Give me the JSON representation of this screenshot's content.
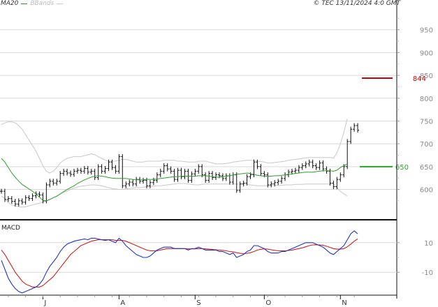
{
  "header": {
    "ma_label": "MA20",
    "bbands_label": "BBands",
    "copyright": "© TEC 13/11/2024 4:0 GMT"
  },
  "macd_panel": {
    "title": "MACD"
  },
  "colors": {
    "price_bar": "#111111",
    "ma20": "#2ca02c",
    "bbands": "#c8c8c8",
    "resistance": "#cc0000",
    "support": "#2ca02c",
    "macd": "#2233cc",
    "signal": "#cc2222",
    "grid": "#d9d9d9"
  },
  "chart_data": {
    "type": "ohlc",
    "title": "",
    "price_axis": {
      "ticks": [
        {
          "value": 950,
          "label": "950"
        },
        {
          "value": 900,
          "label": "900"
        },
        {
          "value": 850,
          "label": "850"
        },
        {
          "value": 800,
          "label": "800"
        },
        {
          "value": 750,
          "label": "750"
        },
        {
          "value": 700,
          "label": "700"
        },
        {
          "value": 650,
          "label": "650"
        },
        {
          "value": 600,
          "label": "600"
        }
      ],
      "ylim": [
        535,
        1000
      ]
    },
    "x_axis": {
      "ticks": [
        {
          "index": 12,
          "label": "J"
        },
        {
          "index": 34,
          "label": "A"
        },
        {
          "index": 56,
          "label": "S"
        },
        {
          "index": 76,
          "label": "O"
        },
        {
          "index": 98,
          "label": "N"
        }
      ],
      "count": 104
    },
    "levels": [
      {
        "name": "resistance",
        "value": 844,
        "label": "844"
      },
      {
        "name": "support",
        "value": 650,
        "label": "650"
      }
    ],
    "price_close": [
      596,
      578,
      580,
      574,
      568,
      575,
      572,
      582,
      580,
      586,
      590,
      588,
      575,
      610,
      618,
      614,
      618,
      635,
      640,
      636,
      633,
      640,
      642,
      640,
      646,
      638,
      640,
      626,
      650,
      640,
      646,
      660,
      648,
      640,
      672,
      608,
      612,
      616,
      612,
      622,
      618,
      620,
      608,
      615,
      620,
      632,
      640,
      652,
      645,
      640,
      622,
      642,
      628,
      640,
      620,
      634,
      640,
      650,
      632,
      620,
      635,
      626,
      632,
      630,
      624,
      630,
      616,
      632,
      598,
      612,
      614,
      628,
      632,
      660,
      650,
      635,
      632,
      610,
      612,
      615,
      618,
      624,
      632,
      638,
      640,
      642,
      648,
      652,
      656,
      660,
      652,
      648,
      658,
      645,
      640,
      614,
      606,
      622,
      632,
      650,
      705,
      732,
      740,
      730
    ],
    "bar_range": 12,
    "ma20": [
      668,
      660,
      648,
      636,
      627,
      618,
      611,
      606,
      601,
      596,
      590,
      583,
      576,
      575,
      578,
      582,
      585,
      590,
      595,
      600,
      604,
      608,
      613,
      617,
      621,
      624,
      627,
      629,
      630,
      629,
      628,
      626,
      625,
      624,
      624,
      624,
      624,
      623,
      622,
      621,
      621,
      621,
      622,
      622,
      622,
      623,
      624,
      625,
      626,
      627,
      628,
      628,
      629,
      629,
      629,
      629,
      629,
      630,
      630,
      630,
      629,
      628,
      627,
      627,
      628,
      629,
      630,
      632,
      633,
      634,
      635,
      636,
      635,
      633,
      631,
      630,
      629,
      629,
      629,
      630,
      630,
      631,
      632,
      633,
      634,
      635,
      636,
      637,
      638,
      638,
      638,
      639,
      640,
      641,
      641,
      641,
      640,
      642,
      648,
      652,
      656
    ],
    "bb_upper": [
      742,
      746,
      748,
      748,
      746,
      740,
      732,
      720,
      708,
      696,
      684,
      668,
      652,
      640,
      636,
      640,
      648,
      658,
      664,
      668,
      670,
      672,
      672,
      672,
      674,
      676,
      678,
      676,
      672,
      668,
      664,
      662,
      662,
      662,
      664,
      666,
      666,
      664,
      662,
      660,
      660,
      660,
      662,
      662,
      662,
      662,
      662,
      664,
      664,
      664,
      664,
      662,
      662,
      661,
      660,
      660,
      660,
      662,
      662,
      662,
      660,
      658,
      656,
      656,
      656,
      657,
      658,
      660,
      661,
      662,
      663,
      664,
      664,
      663,
      662,
      661,
      660,
      658,
      658,
      659,
      660,
      661,
      662,
      664,
      665,
      666,
      667,
      668,
      669,
      670,
      670,
      670,
      670,
      670,
      670,
      670,
      669,
      680,
      700,
      725,
      755
    ],
    "bb_lower": [
      586,
      580,
      571,
      566,
      564,
      562,
      561,
      562,
      564,
      566,
      568,
      570,
      572,
      574,
      578,
      582,
      586,
      590,
      594,
      597,
      600,
      603,
      605,
      607,
      608,
      609,
      610,
      610,
      609,
      608,
      606,
      604,
      602,
      601,
      600,
      600,
      601,
      602,
      603,
      604,
      604,
      605,
      606,
      607,
      607,
      608,
      608,
      609,
      610,
      611,
      612,
      613,
      613,
      613,
      612,
      611,
      610,
      610,
      611,
      612,
      612,
      612,
      612,
      612,
      612,
      612,
      612,
      612,
      612,
      612,
      612,
      611,
      610,
      609,
      608,
      608,
      608,
      608,
      608,
      609,
      609,
      609,
      610,
      610,
      610,
      611,
      611,
      611,
      612,
      612,
      612,
      612,
      612,
      612,
      612,
      612,
      612,
      604,
      596,
      590,
      586
    ],
    "macd_axis": {
      "ticks": [
        {
          "value": 10,
          "label": "10"
        },
        {
          "value": -10,
          "label": "-10"
        }
      ],
      "ylim": [
        -25,
        25
      ]
    },
    "macd": [
      -2,
      -8,
      -14,
      -18,
      -21,
      -23,
      -24,
      -23,
      -22,
      -21,
      -20,
      -18,
      -15,
      -10,
      -6,
      -3,
      0,
      4,
      7,
      9,
      10,
      11,
      11.5,
      12,
      12.5,
      12,
      13,
      13,
      12.5,
      12,
      11.5,
      12,
      11,
      10,
      13,
      11,
      8,
      6,
      4,
      2,
      1,
      0,
      0,
      1,
      3,
      5,
      6,
      7,
      7,
      7,
      6,
      6,
      6,
      6,
      5,
      6,
      6,
      7,
      6,
      5,
      5,
      5,
      5,
      4,
      4,
      3,
      2,
      3,
      0,
      1,
      2,
      4,
      5,
      8,
      8,
      7,
      6,
      4,
      3,
      3,
      3,
      4,
      4,
      5,
      6,
      7,
      8,
      9,
      10,
      10,
      10,
      9,
      8,
      7,
      5,
      3,
      2,
      4,
      6,
      8,
      12,
      16,
      18,
      16
    ],
    "signal": [
      5,
      2,
      -2,
      -6,
      -10,
      -13,
      -16,
      -18,
      -19,
      -20,
      -20,
      -20,
      -19,
      -17,
      -15,
      -13,
      -10,
      -7,
      -4,
      -1,
      2,
      4,
      6,
      8,
      9,
      10,
      11,
      11.5,
      12,
      12,
      12,
      12,
      12,
      11.5,
      11.5,
      11.5,
      11,
      10,
      9,
      8,
      7,
      6,
      5,
      4.5,
      4.5,
      4.5,
      5,
      5.5,
      6,
      6,
      6,
      6,
      6,
      6,
      5.8,
      5.8,
      5.8,
      6,
      6,
      5.8,
      5.6,
      5.4,
      5.2,
      5,
      4.8,
      4.5,
      4,
      3.8,
      3.2,
      2.8,
      2.6,
      2.8,
      3.2,
      4,
      5,
      5.5,
      5.8,
      5.6,
      5.2,
      4.8,
      4.5,
      4.5,
      4.5,
      4.7,
      5,
      5.5,
      6,
      6.5,
      7.2,
      8,
      8.5,
      8.6,
      8.5,
      8.2,
      7.6,
      6.8,
      6,
      5.6,
      5.6,
      6,
      7.2,
      9,
      11,
      12.5
    ]
  }
}
